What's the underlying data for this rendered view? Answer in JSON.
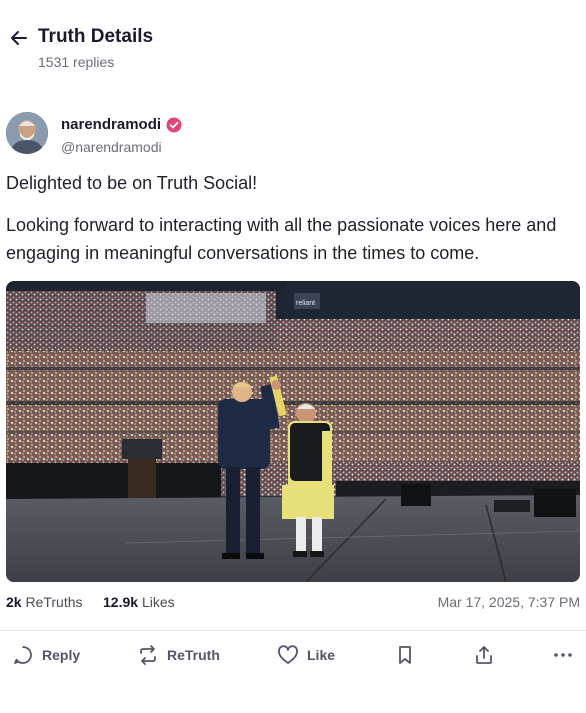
{
  "header": {
    "title": "Truth Details",
    "replies": "1531 replies",
    "back_icon": "arrow-left-icon"
  },
  "author": {
    "display_name": "narendramodi",
    "handle": "@narendramodi",
    "verified_color": "#e0457b"
  },
  "post": {
    "paragraphs": [
      "Delighted to be on Truth Social!",
      "Looking forward to interacting with all the passionate voices here and engaging in meaningful conversations in the times to come."
    ]
  },
  "media": {
    "stadium_sign": "reliant"
  },
  "stats": {
    "retruths_count": "2k",
    "retruths_label": "ReTruths",
    "likes_count": "12.9k",
    "likes_label": "Likes",
    "timestamp": "Mar 17, 2025, 7:37 PM"
  },
  "actions": {
    "reply": "Reply",
    "retruth": "ReTruth",
    "like": "Like",
    "icons": [
      "reply-icon",
      "retruth-icon",
      "heart-icon",
      "bookmark-icon",
      "share-icon",
      "more-icon"
    ]
  },
  "colors": {
    "text": "#1a1a2e",
    "muted": "#6b6b7b",
    "divider": "#e6e6ec"
  }
}
